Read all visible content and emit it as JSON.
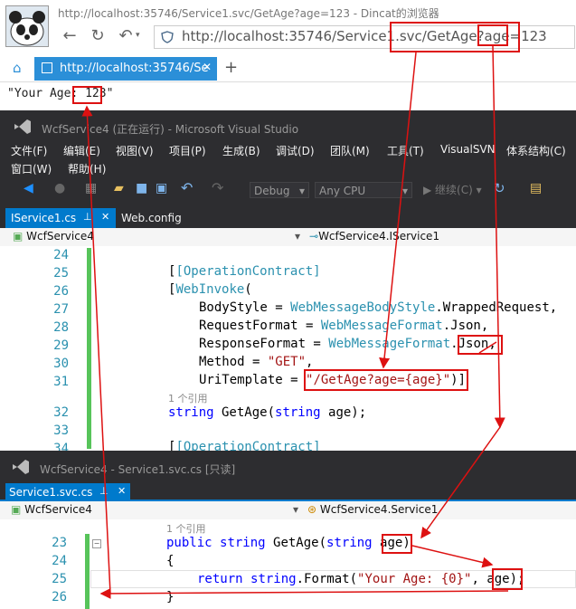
{
  "browser": {
    "title": "http://localhost:35746/Service1.svc/GetAge?age=123 - Dincat的浏览器",
    "address": "http://localhost:35746/Service1.svc/GetAge?age=123",
    "address_prefix": "http://localhost:35746/Service1.svc",
    "address_path": "/GetAge?age=",
    "address_value": "123",
    "tab_label": "http://localhost:35746/Se",
    "response_prefix": "\"Your Age: ",
    "response_value": "123",
    "response_suffix": "\""
  },
  "vs1": {
    "title": "WcfService4 (正在运行) - Microsoft Visual Studio",
    "menu": [
      "文件(F)",
      "编辑(E)",
      "视图(V)",
      "项目(P)",
      "生成(B)",
      "调试(D)",
      "团队(M)",
      "工具(T)",
      "VisualSVN",
      "体系结构(C)",
      "窗口(W)",
      "帮助(H)"
    ],
    "config": "Debug",
    "platform": "Any CPU",
    "continue": "继续(C)",
    "tabs": [
      "IService1.cs",
      "Web.config"
    ],
    "nav_left": "WcfService4",
    "nav_right": "WcfService4.IService1",
    "lines": [
      "24",
      "25",
      "26",
      "27",
      "28",
      "29",
      "30",
      "31",
      "",
      "32",
      "33",
      "34"
    ],
    "ref_count": "1 个引用",
    "code": {
      "l25": "[OperationContract]",
      "l26_a": "[",
      "l26_b": "WebInvoke",
      "l26_c": "(",
      "l27_a": "BodyStyle = ",
      "l27_b": "WebMessageBodyStyle",
      "l27_c": ".WrappedRequest,",
      "l28_a": "RequestFormat = ",
      "l28_b": "WebMessageFormat",
      "l28_c": ".Json,",
      "l29_a": "ResponseFormat = ",
      "l29_b": "WebMessageFormat",
      "l29_c": ".",
      "l29_d": "Json",
      "l29_e": ",",
      "l30_a": "Method = ",
      "l30_b": "\"GET\"",
      "l30_c": ",",
      "l31_a": "UriTemplate = ",
      "l31_b": "\"/GetAge?age={age}\"",
      "l31_c": ")]",
      "l32_a": "string",
      "l32_b": " GetAge(",
      "l32_c": "string",
      "l32_d": " age);",
      "l34": "[OperationContract]"
    }
  },
  "vs2": {
    "title": "WcfService4 - Service1.svc.cs [只读]",
    "tab": "Service1.svc.cs",
    "nav_left": "WcfService4",
    "nav_right": "WcfService4.Service1",
    "lines": [
      "",
      "23",
      "24",
      "25",
      "26"
    ],
    "ref_count": "1 个引用",
    "code": {
      "l23_a": "public",
      "l23_b": "string",
      "l23_c": " GetAge(",
      "l23_d": "string",
      "l23_e": "age",
      "l23_f": ")",
      "l24": "{",
      "l25_a": "return",
      "l25_b": "string",
      "l25_c": ".Format(",
      "l25_d": "\"Your Age: {0}\"",
      "l25_e": ", ",
      "l25_f": "age",
      "l25_g": ");",
      "l26": "}"
    }
  },
  "colors": {
    "annotation": "#dd1111",
    "vs_chrome": "#2d2d30",
    "vs_accent": "#007acc",
    "browser_tab": "#2b8fd8"
  }
}
